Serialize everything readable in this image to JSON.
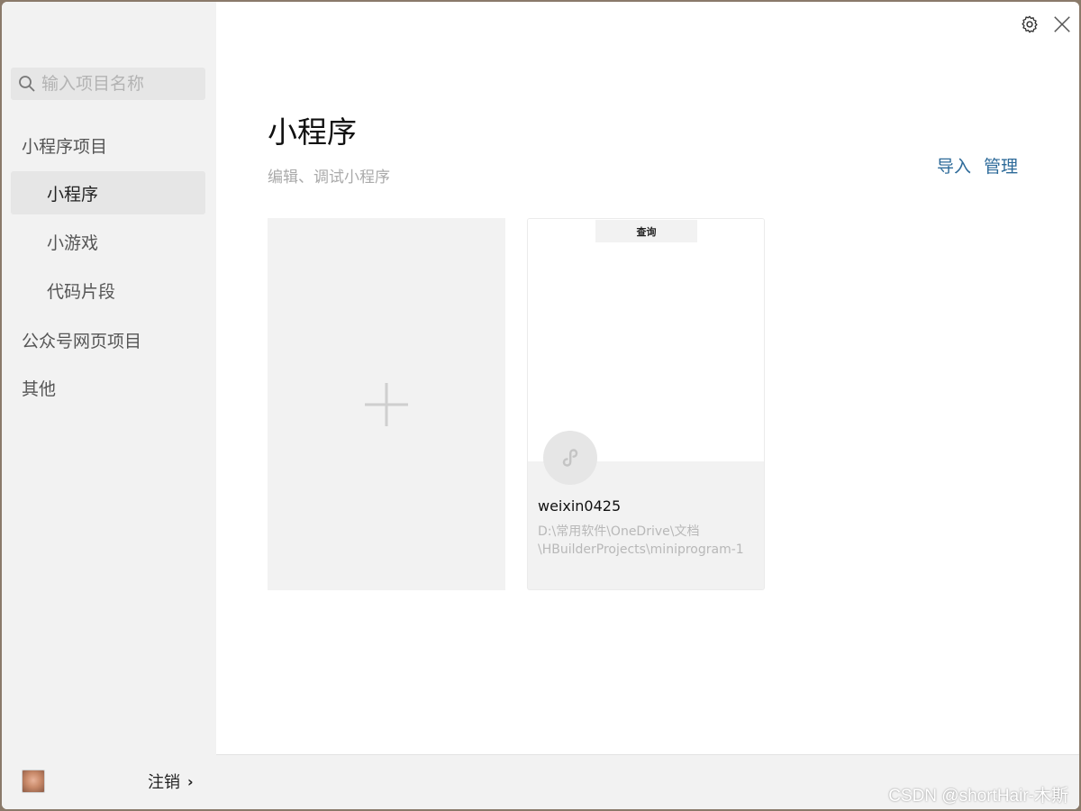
{
  "search": {
    "placeholder": "输入项目名称"
  },
  "sidebar": {
    "groups": [
      {
        "label": "小程序项目",
        "items": [
          {
            "label": "小程序",
            "active": true
          },
          {
            "label": "小游戏"
          },
          {
            "label": "代码片段"
          }
        ]
      },
      {
        "label": "公众号网页项目"
      },
      {
        "label": "其他"
      }
    ],
    "logout_label": "注销",
    "logout_chevron": "›"
  },
  "main": {
    "title": "小程序",
    "subtitle": "编辑、调试小程序",
    "actions": {
      "import": "导入",
      "manage": "管理"
    }
  },
  "projects": [
    {
      "preview_tab": "查询",
      "name": "weixin0425",
      "path": "D:\\常用软件\\OneDrive\\文档\\HBuilderProjects\\miniprogram-1"
    }
  ],
  "icons": {
    "search": "search-icon",
    "settings": "gear-icon",
    "close": "close-icon",
    "add": "plus-icon",
    "miniprogram": "miniprogram-logo-icon"
  },
  "colors": {
    "accent": "#2d6a99",
    "sidebar_bg": "#f2f2f2",
    "active_bg": "#e6e6e6"
  },
  "watermark": "CSDN @shortHair-木斯"
}
